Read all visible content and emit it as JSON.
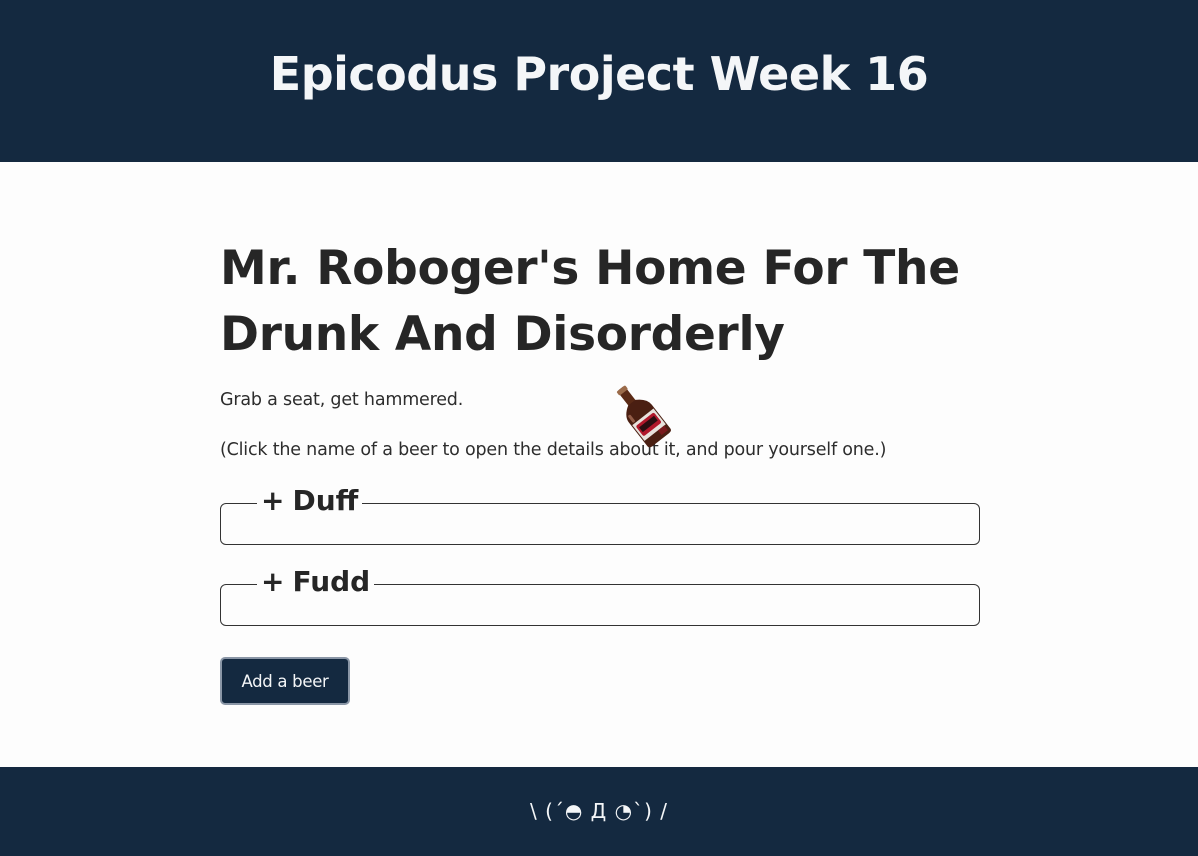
{
  "header": {
    "title": "Epicodus Project Week 16"
  },
  "main": {
    "title": "Mr. Roboger's Home For The Drunk And Disorderly",
    "tagline": "Grab a seat, get hammered.",
    "instructions": "(Click the name of a beer to open the details about it, and pour yourself one.)",
    "beers": [
      {
        "toggle": "+",
        "name": "Duff"
      },
      {
        "toggle": "+",
        "name": "Fudd"
      }
    ],
    "add_button_label": "Add a beer"
  },
  "footer": {
    "text": "\\ (´◓ Д ◔`) /"
  },
  "icons": {
    "bottle": "beer-bottle-icon"
  },
  "colors": {
    "bar_background": "#142940",
    "page_background": "#fdfdfd",
    "text": "#262626"
  }
}
